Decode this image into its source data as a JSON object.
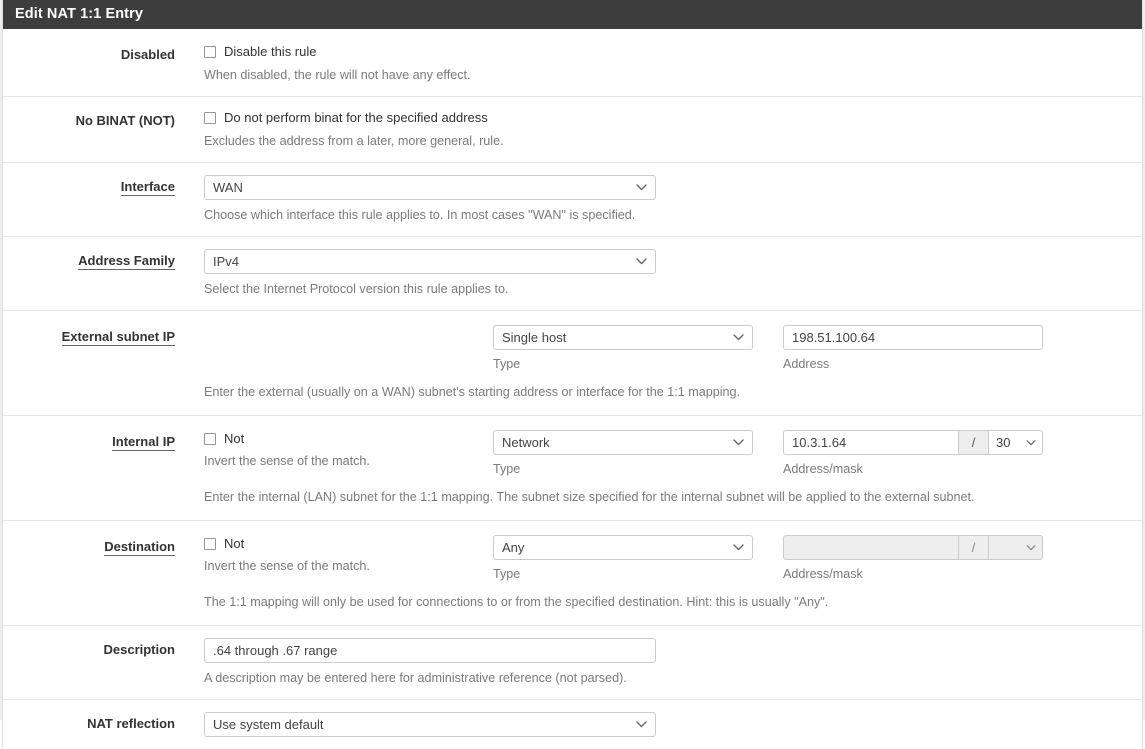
{
  "header": {
    "title": "Edit NAT 1:1 Entry",
    "bg_color": "#3d3d3d"
  },
  "form": {
    "rows": {
      "disabled": {
        "label": "Disabled",
        "checkbox_label": "Disable this rule",
        "checked": false,
        "help": "When disabled, the rule will not have any effect."
      },
      "no_binat": {
        "label": "No BINAT (NOT)",
        "checkbox_label": "Do not perform binat for the specified address",
        "checked": false,
        "help": "Excludes the address from a later, more general, rule."
      },
      "interface": {
        "label": "Interface",
        "required": true,
        "value": "WAN",
        "help": "Choose which interface this rule applies to. In most cases \"WAN\" is specified."
      },
      "address_family": {
        "label": "Address Family",
        "required": true,
        "value": "IPv4",
        "help": "Select the Internet Protocol version this rule applies to."
      },
      "external_subnet_ip": {
        "label": "External subnet IP",
        "required": true,
        "type_value": "Single host",
        "type_sublabel": "Type",
        "address_value": "198.51.100.64",
        "address_sublabel": "Address",
        "help": "Enter the external (usually on a WAN) subnet's starting address or interface for the 1:1 mapping."
      },
      "internal_ip": {
        "label": "Internal IP",
        "required": true,
        "not_label": "Not",
        "not_checked": false,
        "not_help": "Invert the sense of the match.",
        "type_value": "Network",
        "type_sublabel": "Type",
        "address_value": "10.3.1.64",
        "mask_separator": "/",
        "mask_value": "30",
        "address_sublabel": "Address/mask",
        "help": "Enter the internal (LAN) subnet for the 1:1 mapping. The subnet size specified for the internal subnet will be applied to the external subnet."
      },
      "destination": {
        "label": "Destination",
        "required": true,
        "not_label": "Not",
        "not_checked": false,
        "not_help": "Invert the sense of the match.",
        "type_value": "Any",
        "type_sublabel": "Type",
        "address_value": "",
        "mask_separator": "/",
        "mask_value": "",
        "address_sublabel": "Address/mask",
        "disabled": true,
        "help": "The 1:1 mapping will only be used for connections to or from the specified destination. Hint: this is usually \"Any\"."
      },
      "description": {
        "label": "Description",
        "value": ".64 through .67 range",
        "help": "A description may be entered here for administrative reference (not parsed)."
      },
      "nat_reflection": {
        "label": "NAT reflection",
        "value": "Use system default"
      }
    }
  },
  "icons": {
    "chevron_down": "chevron-down-icon"
  }
}
